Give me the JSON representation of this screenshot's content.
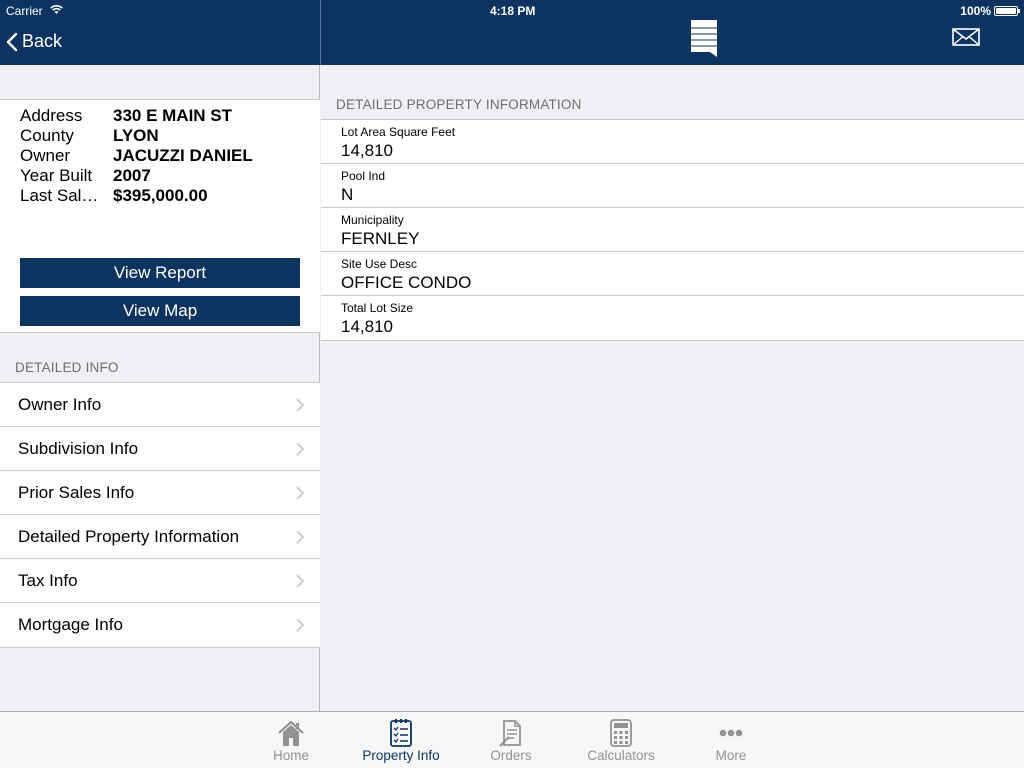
{
  "status_bar": {
    "carrier": "Carrier",
    "time": "4:18 PM",
    "battery": "100%"
  },
  "nav": {
    "back_label": "Back"
  },
  "summary": {
    "rows": [
      {
        "key": "Address",
        "value": "330 E MAIN ST"
      },
      {
        "key": "County",
        "value": "LYON"
      },
      {
        "key": "Owner",
        "value": "JACUZZI DANIEL"
      },
      {
        "key": "Year Built",
        "value": "2007"
      },
      {
        "key": "Last Sal…",
        "value": "$395,000.00"
      }
    ],
    "view_report_label": "View Report",
    "view_map_label": "View Map"
  },
  "detailed_info": {
    "header": "DETAILED INFO",
    "items": [
      {
        "label": "Owner Info"
      },
      {
        "label": "Subdivision Info"
      },
      {
        "label": "Prior Sales Info"
      },
      {
        "label": "Detailed Property Information"
      },
      {
        "label": "Tax Info"
      },
      {
        "label": "Mortgage Info"
      }
    ]
  },
  "detail_panel": {
    "header": "DETAILED PROPERTY INFORMATION",
    "fields": [
      {
        "label": "Lot Area Square Feet",
        "value": "14,810"
      },
      {
        "label": "Pool Ind",
        "value": "N"
      },
      {
        "label": "Municipality",
        "value": "FERNLEY"
      },
      {
        "label": "Site Use Desc",
        "value": "OFFICE CONDO"
      },
      {
        "label": "Total Lot Size",
        "value": "14,810"
      }
    ]
  },
  "tabbar": {
    "tabs": [
      {
        "label": "Home",
        "icon": "home-icon"
      },
      {
        "label": "Property Info",
        "icon": "property-info-icon",
        "active": true
      },
      {
        "label": "Orders",
        "icon": "orders-icon"
      },
      {
        "label": "Calculators",
        "icon": "calculator-icon"
      },
      {
        "label": "More",
        "icon": "more-icon"
      }
    ]
  },
  "colors": {
    "brand": "#0d3460",
    "background": "#efeff4",
    "tab_inactive": "#929292"
  }
}
